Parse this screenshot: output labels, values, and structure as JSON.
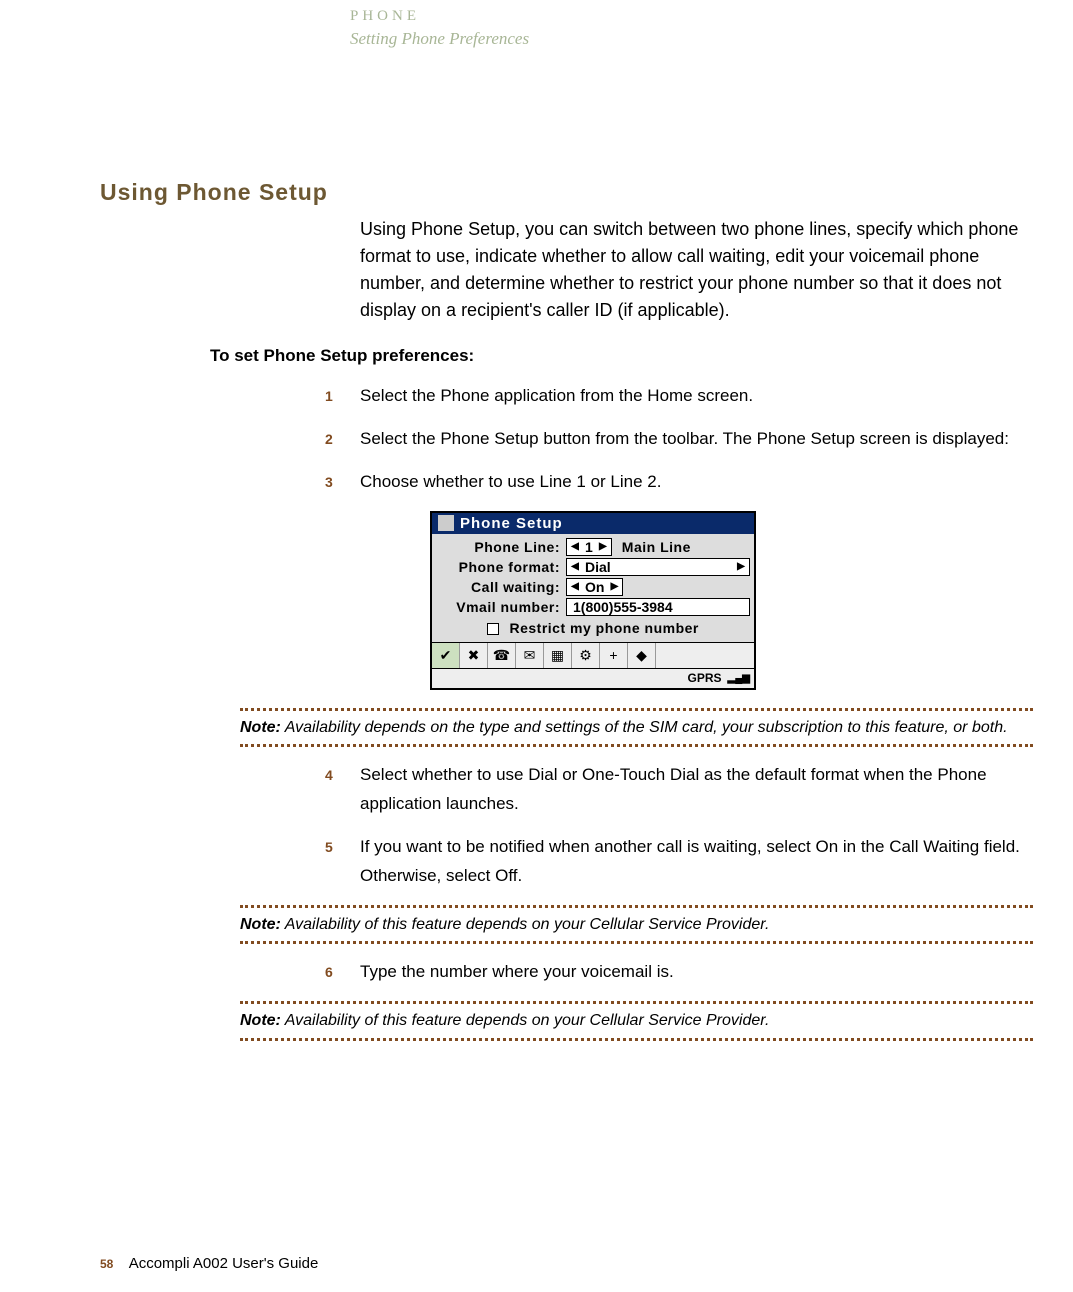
{
  "header": {
    "category": "PHONE",
    "subtitle": "Setting Phone Preferences"
  },
  "section": {
    "title": "Using Phone Setup",
    "intro": "Using Phone Setup, you can switch between two phone lines, specify which phone format to use, indicate whether to allow call waiting, edit your voicemail phone number, and determine whether to restrict your phone number so that it does not display on a recipient's caller ID (if applicable).",
    "subheading": "To set Phone Setup preferences:"
  },
  "steps": {
    "s1": {
      "n": "1",
      "t": "Select the Phone application from the Home screen."
    },
    "s2": {
      "n": "2",
      "t": "Select the Phone Setup button from the toolbar.  The Phone Setup screen is displayed:"
    },
    "s3": {
      "n": "3",
      "t": "Choose whether to use Line 1 or Line 2."
    },
    "s4": {
      "n": "4",
      "t": "Select whether to use Dial or One-Touch Dial as the default format when the Phone application launches."
    },
    "s5": {
      "n": "5",
      "t": "If you want to be notified when another call is waiting, select On in the Call Waiting field. Otherwise, select Off."
    },
    "s6": {
      "n": "6",
      "t": " Type the number where your voicemail is."
    }
  },
  "phone_setup": {
    "title": "Phone Setup",
    "rows": {
      "line": {
        "label": "Phone Line:",
        "value": "1",
        "after": "Main Line"
      },
      "format": {
        "label": "Phone format:",
        "value": "Dial"
      },
      "call": {
        "label": "Call waiting:",
        "value": "On"
      },
      "vmail": {
        "label": "Vmail number:",
        "value": "1(800)555-3984"
      }
    },
    "restrict": "Restrict my phone number",
    "status": "GPRS"
  },
  "notes": {
    "n1": {
      "label": "Note:",
      "t": " Availability depends on the type and settings of the SIM card, your subscription to this feature, or both."
    },
    "n2": {
      "label": "Note:",
      "t": " Availability of this feature depends on your Cellular Service Provider."
    },
    "n3": {
      "label": "Note:",
      "t": " Availability of this feature depends on your Cellular Service Provider."
    }
  },
  "footer": {
    "page": "58",
    "guide": "Accompli A002 User's Guide"
  }
}
